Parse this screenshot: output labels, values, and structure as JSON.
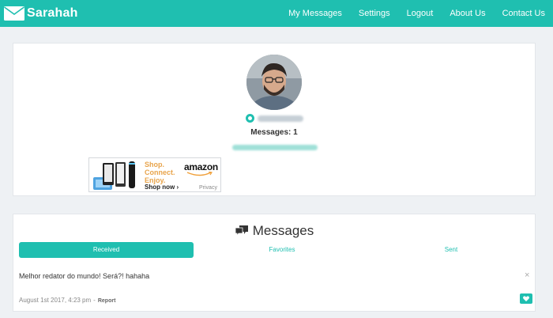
{
  "navbar": {
    "brand": "Sarahah",
    "links": [
      "My Messages",
      "Settings",
      "Logout",
      "About Us",
      "Contact Us"
    ],
    "color": "#1fbfb0"
  },
  "profile": {
    "messages_count": "Messages: 1"
  },
  "ad": {
    "slogan": [
      "Shop.",
      "Connect.",
      "Enjoy."
    ],
    "cta": "Shop now ›",
    "brand": "amazon",
    "privacy": "Privacy"
  },
  "messages": {
    "title": "Messages",
    "tabs": [
      "Received",
      "Favorites",
      "Sent"
    ],
    "items": [
      {
        "text": "Melhor redator do mundo! Será?! hahaha",
        "date": "August 1st 2017, 4:23 pm",
        "sep": "-",
        "report": "Report"
      }
    ]
  }
}
